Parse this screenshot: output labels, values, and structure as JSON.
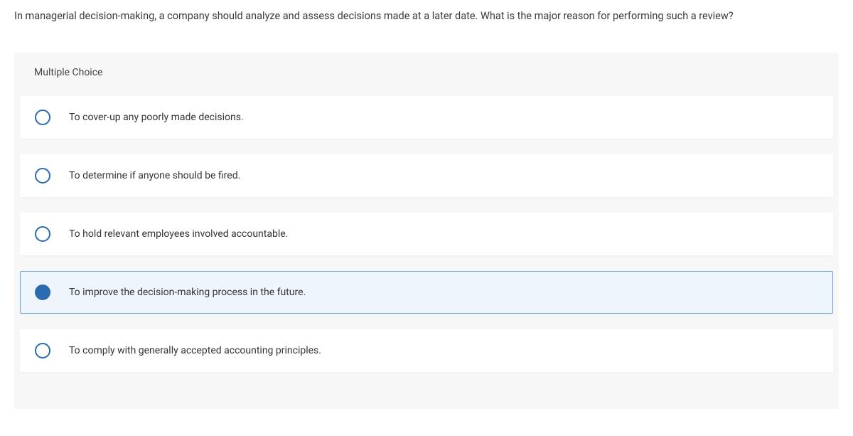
{
  "question": "In managerial decision-making, a company should analyze and assess decisions made at a later date. What is the major reason for performing such a review?",
  "section_label": "Multiple Choice",
  "options": [
    {
      "text": "To cover-up any poorly made decisions.",
      "selected": false
    },
    {
      "text": "To determine if anyone should be fired.",
      "selected": false
    },
    {
      "text": "To hold relevant employees involved accountable.",
      "selected": false
    },
    {
      "text": "To improve the decision-making process in the future.",
      "selected": true
    },
    {
      "text": "To comply with generally accepted accounting principles.",
      "selected": false
    }
  ]
}
